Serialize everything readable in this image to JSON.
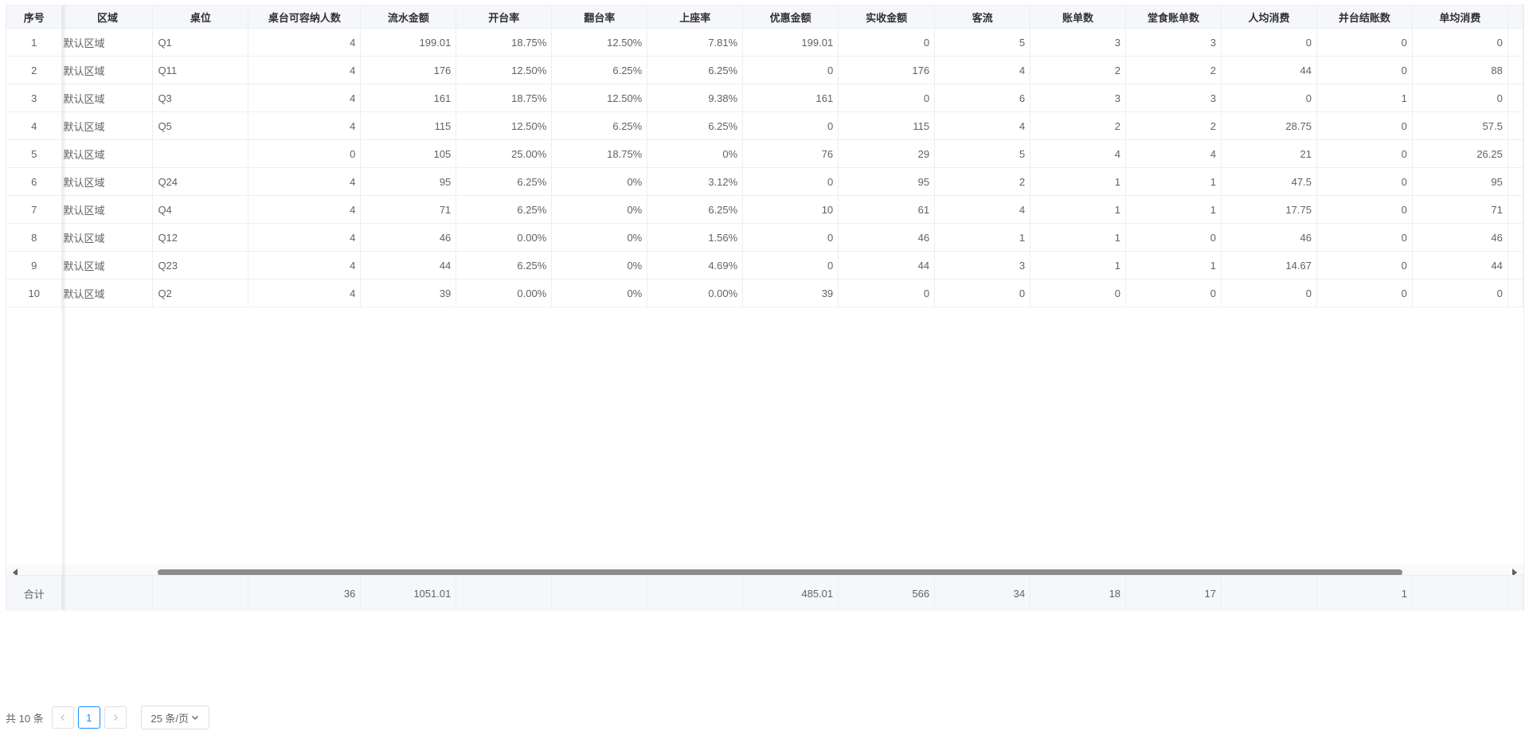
{
  "table": {
    "columns": [
      "序号",
      "区域",
      "桌位",
      "桌台可容纳人数",
      "流水金额",
      "开台率",
      "翻台率",
      "上座率",
      "优惠金额",
      "实收金额",
      "客流",
      "账单数",
      "堂食账单数",
      "人均消费",
      "并台结账数",
      "单均消费"
    ],
    "rows": [
      [
        "1",
        "默认区域",
        "Q1",
        "4",
        "199.01",
        "18.75%",
        "12.50%",
        "7.81%",
        "199.01",
        "0",
        "5",
        "3",
        "3",
        "0",
        "0",
        "0"
      ],
      [
        "2",
        "默认区域",
        "Q11",
        "4",
        "176",
        "12.50%",
        "6.25%",
        "6.25%",
        "0",
        "176",
        "4",
        "2",
        "2",
        "44",
        "0",
        "88"
      ],
      [
        "3",
        "默认区域",
        "Q3",
        "4",
        "161",
        "18.75%",
        "12.50%",
        "9.38%",
        "161",
        "0",
        "6",
        "3",
        "3",
        "0",
        "1",
        "0"
      ],
      [
        "4",
        "默认区域",
        "Q5",
        "4",
        "115",
        "12.50%",
        "6.25%",
        "6.25%",
        "0",
        "115",
        "4",
        "2",
        "2",
        "28.75",
        "0",
        "57.5"
      ],
      [
        "5",
        "默认区域",
        "",
        "0",
        "105",
        "25.00%",
        "18.75%",
        "0%",
        "76",
        "29",
        "5",
        "4",
        "4",
        "21",
        "0",
        "26.25"
      ],
      [
        "6",
        "默认区域",
        "Q24",
        "4",
        "95",
        "6.25%",
        "0%",
        "3.12%",
        "0",
        "95",
        "2",
        "1",
        "1",
        "47.5",
        "0",
        "95"
      ],
      [
        "7",
        "默认区域",
        "Q4",
        "4",
        "71",
        "6.25%",
        "0%",
        "6.25%",
        "10",
        "61",
        "4",
        "1",
        "1",
        "17.75",
        "0",
        "71"
      ],
      [
        "8",
        "默认区域",
        "Q12",
        "4",
        "46",
        "0.00%",
        "0%",
        "1.56%",
        "0",
        "46",
        "1",
        "1",
        "0",
        "46",
        "0",
        "46"
      ],
      [
        "9",
        "默认区域",
        "Q23",
        "4",
        "44",
        "6.25%",
        "0%",
        "4.69%",
        "0",
        "44",
        "3",
        "1",
        "1",
        "14.67",
        "0",
        "44"
      ],
      [
        "10",
        "默认区域",
        "Q2",
        "4",
        "39",
        "0.00%",
        "0%",
        "0.00%",
        "39",
        "0",
        "0",
        "0",
        "0",
        "0",
        "0",
        "0"
      ]
    ],
    "summary": [
      "合计",
      "",
      "",
      "36",
      "1051.01",
      "",
      "",
      "",
      "485.01",
      "566",
      "34",
      "18",
      "17",
      "",
      "1",
      ""
    ]
  },
  "pagination": {
    "total_text": "共 10 条",
    "current_page": "1",
    "page_size": "25 条/页"
  }
}
